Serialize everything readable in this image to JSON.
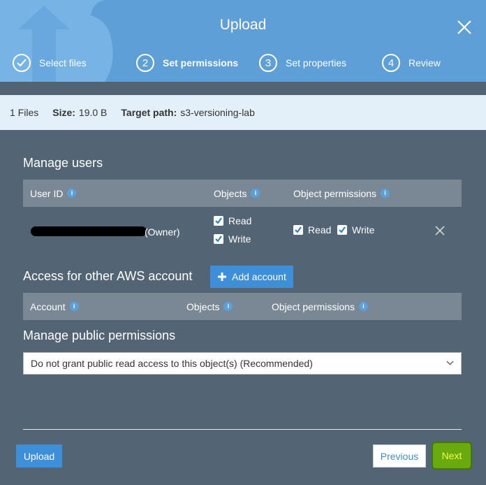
{
  "dialog": {
    "title": "Upload"
  },
  "steps": [
    {
      "number": "1",
      "label": "Select files",
      "state": "completed"
    },
    {
      "number": "2",
      "label": "Set permissions",
      "state": "active"
    },
    {
      "number": "3",
      "label": "Set properties",
      "state": "pending"
    },
    {
      "number": "4",
      "label": "Review",
      "state": "pending"
    }
  ],
  "info_bar": {
    "files": "1 Files",
    "size_label": "Size:",
    "size_value": "19.0 B",
    "target_label": "Target path:",
    "target_value": "s3-versioning-lab"
  },
  "manage_users": {
    "heading": "Manage users",
    "columns": {
      "user_id": "User ID",
      "objects": "Objects",
      "object_permissions": "Object permissions"
    },
    "row": {
      "owner_suffix": "(Owner)",
      "objects_read": "Read",
      "objects_write": "Write",
      "perm_read": "Read",
      "perm_write": "Write"
    }
  },
  "other_accounts": {
    "heading": "Access for other AWS account",
    "add_button": "Add account",
    "columns": {
      "account": "Account",
      "objects": "Objects",
      "object_permissions": "Object permissions"
    }
  },
  "public_permissions": {
    "heading": "Manage public permissions",
    "selected": "Do not grant public read access to this object(s) (Recommended)"
  },
  "footer": {
    "upload": "Upload",
    "previous": "Previous",
    "next": "Next"
  },
  "icons": {
    "info": "info-icon",
    "checkbox": "checkbox-checked-icon",
    "remove": "remove-icon",
    "plus": "plus-icon",
    "chevron": "chevron-down-icon",
    "close": "close-icon"
  },
  "colors": {
    "header": "#5e9fd8",
    "panel": "#536474",
    "table_header": "#7a8896",
    "accent": "#3d8fd9",
    "next": "#6aaa0e",
    "next_text": "#f3ff4a"
  }
}
